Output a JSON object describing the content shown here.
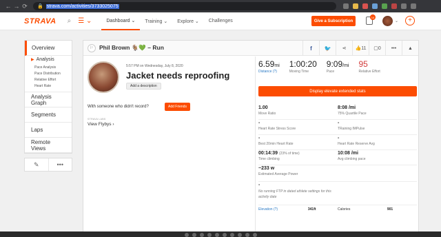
{
  "browser": {
    "url": "strava.com/activities/3733025075"
  },
  "header": {
    "logo": "STRAVA",
    "nav": [
      "Dashboard ⌄",
      "Training ⌄",
      "Explore ⌄",
      "Challenges"
    ],
    "subscribe_label": "Give a Subscription",
    "notification_count": "14"
  },
  "sidenav": {
    "overview": "Overview",
    "analysis": "Analysis",
    "analysis_items": [
      "Pace Analysis",
      "Pace Distribution",
      "Relative Effort",
      "Heart Rate"
    ],
    "items": [
      "Analysis Graph",
      "Segments",
      "Laps",
      "Remote Views"
    ],
    "edit_icon": "✎",
    "more_icon": "•••"
  },
  "activity": {
    "athlete_title": "Phil Brown 🐐💚 – Run",
    "meta": "5:57 PM on Wednesday, July 8, 2020",
    "title": "Jacket needs reproofing",
    "add_description": "Add a description",
    "with_someone": "With someone who didn't record?",
    "add_friends": "Add Friends",
    "flyby_label": "STRAVA LABS",
    "flyby": "View Flybys ›",
    "kudos_count": "11",
    "comment_count": "0"
  },
  "stats": {
    "distance": {
      "value": "6.59",
      "unit": "mi",
      "label": "Distance (?)"
    },
    "moving_time": {
      "value": "1:00:20",
      "label": "Moving Time"
    },
    "pace": {
      "value": "9:09",
      "unit": "/mi",
      "label": "Pace"
    },
    "relative_effort": {
      "value": "95",
      "label": "Relative Effort"
    },
    "display_elevate": "Display elevate extended stats",
    "move_ratio": {
      "value": "1.00",
      "label": "Move Ratio"
    },
    "quartile_pace": {
      "value": "8:08 /mi",
      "label": "75% Quartile Pace"
    },
    "hr_stress": {
      "value": "-",
      "label": "Heart Rate Stress Score"
    },
    "trimp": {
      "value": "-",
      "label": "TRaining IMPulse"
    },
    "best_hr": {
      "value": "-",
      "label": "Best 20min Heart Rate"
    },
    "hr_reserve": {
      "value": "-",
      "label": "Heart Rate Reserve Avg"
    },
    "time_climbing": {
      "value": "00:14:39",
      "extra": "(23% of time)",
      "label": "Time climbing"
    },
    "avg_climbing_pace": {
      "value": "10:08 /mi",
      "label": "Avg climbing pace"
    },
    "power": {
      "value": "~233 w",
      "label": "Estimated Average Power"
    },
    "ftp": {
      "value": "-",
      "label": "No running FTP in dated athlete settings for this activity date"
    },
    "elevation": {
      "label": "Elevation (?)",
      "value": "341ft"
    },
    "calories": {
      "label": "Calories",
      "value": "901"
    }
  }
}
